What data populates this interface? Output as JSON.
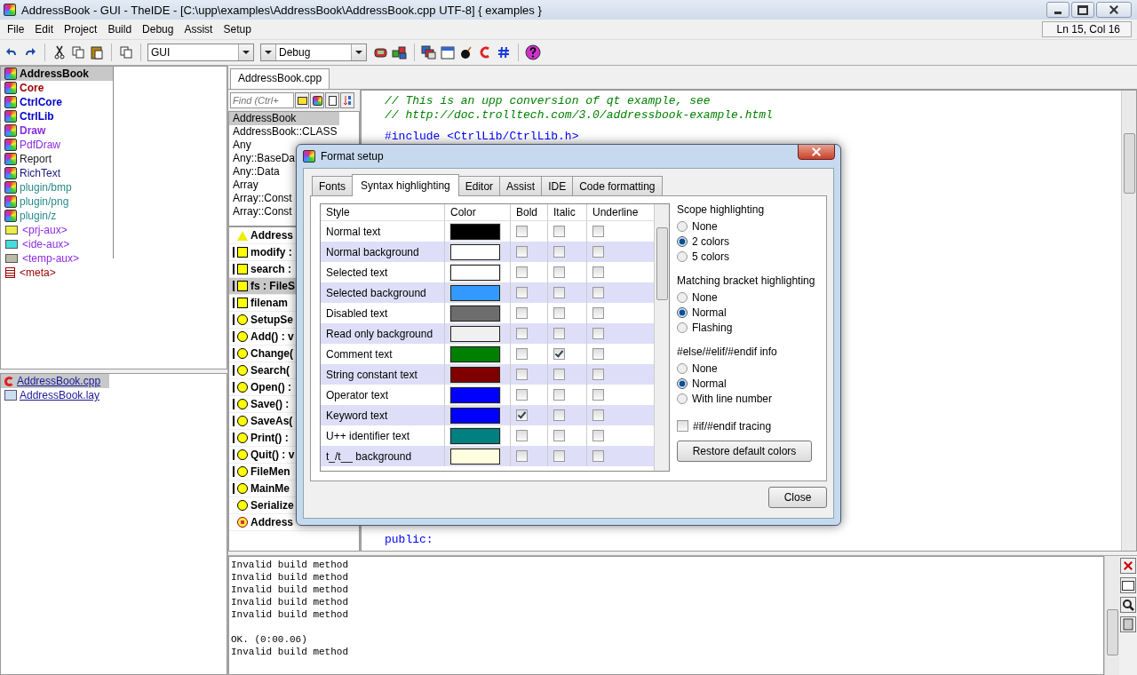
{
  "window": {
    "title": "AddressBook - GUI - TheIDE - [C:\\upp\\examples\\AddressBook\\AddressBook.cpp UTF-8] { examples }"
  },
  "menu": [
    "File",
    "Edit",
    "Project",
    "Build",
    "Debug",
    "Assist",
    "Setup"
  ],
  "status": "Ln 15, Col 16",
  "toolbar": {
    "config": "GUI",
    "build_mode": "Debug"
  },
  "packages": [
    {
      "name": "AddressBook",
      "color": "#000000",
      "bold": true,
      "selected": true
    },
    {
      "name": "Core",
      "color": "#990000",
      "bold": true,
      "selected": false
    },
    {
      "name": "CtrlCore",
      "color": "#0000cc",
      "bold": true,
      "selected": false
    },
    {
      "name": "CtrlLib",
      "color": "#0000cc",
      "bold": true,
      "selected": false
    },
    {
      "name": "Draw",
      "color": "#8a2be2",
      "bold": true,
      "selected": false
    },
    {
      "name": "PdfDraw",
      "color": "#8a2be2",
      "bold": false,
      "selected": false
    },
    {
      "name": "Report",
      "color": "#222222",
      "bold": false,
      "selected": false
    },
    {
      "name": "RichText",
      "color": "#1a1a7a",
      "bold": false,
      "selected": false
    },
    {
      "name": "plugin/bmp",
      "color": "#2a8a8a",
      "bold": false,
      "selected": false
    },
    {
      "name": "plugin/png",
      "color": "#2a8a8a",
      "bold": false,
      "selected": false
    },
    {
      "name": "plugin/z",
      "color": "#2a8a8a",
      "bold": false,
      "selected": false
    },
    {
      "name": "<prj-aux>",
      "kind": "aux",
      "color": "#8a2be2",
      "bold": false,
      "selected": false
    },
    {
      "name": "<ide-aux>",
      "kind": "aux",
      "color": "#8a2be2",
      "bold": false,
      "selected": false
    },
    {
      "name": "<temp-aux>",
      "kind": "aux",
      "color": "#8a2be2",
      "bold": false,
      "selected": false
    },
    {
      "name": "<meta>",
      "kind": "meta",
      "color": "#990000",
      "bold": false,
      "selected": false
    }
  ],
  "files": [
    {
      "name": "AddressBook.cpp",
      "kind": "cpp",
      "selected": true
    },
    {
      "name": "AddressBook.lay",
      "kind": "lay",
      "selected": false
    }
  ],
  "editor_tab": "AddressBook.cpp",
  "find": {
    "placeholder": "Find (Ctrl+"
  },
  "navigator": [
    {
      "text": "AddressBook",
      "selected": true
    },
    {
      "text": "AddressBook::CLASS",
      "selected": false
    },
    {
      "text": "Any",
      "selected": false
    },
    {
      "text": "Any::BaseDa",
      "selected": false
    },
    {
      "text": "Any::Data",
      "selected": false
    },
    {
      "text": "Array",
      "selected": false
    },
    {
      "text": "Array::Const",
      "selected": false
    },
    {
      "text": "Array::Const",
      "selected": false
    }
  ],
  "symbols": [
    {
      "text": "Address",
      "kind": "class",
      "selected": false
    },
    {
      "text": "modify :",
      "kind": "field",
      "selected": false
    },
    {
      "text": "search :",
      "kind": "field",
      "selected": false
    },
    {
      "text": "fs : FileS",
      "kind": "field",
      "selected": true
    },
    {
      "text": "filenam",
      "kind": "field",
      "selected": false
    },
    {
      "text": "SetupSe",
      "kind": "method",
      "selected": false
    },
    {
      "text": "Add() : v",
      "kind": "method",
      "selected": false
    },
    {
      "text": "Change(",
      "kind": "method",
      "selected": false
    },
    {
      "text": "Search(",
      "kind": "method",
      "selected": false
    },
    {
      "text": "Open() :",
      "kind": "method",
      "selected": false
    },
    {
      "text": "Save() :",
      "kind": "method",
      "selected": false
    },
    {
      "text": "SaveAs(",
      "kind": "method",
      "selected": false
    },
    {
      "text": "Print() :",
      "kind": "method",
      "selected": false
    },
    {
      "text": "Quit() : v",
      "kind": "method",
      "selected": false
    },
    {
      "text": "FileMen",
      "kind": "method",
      "selected": false
    },
    {
      "text": "MainMe",
      "kind": "method",
      "selected": false
    },
    {
      "text": "Serialize",
      "kind": "function",
      "selected": false
    },
    {
      "text": "Address",
      "kind": "constructor",
      "selected": false
    }
  ],
  "code": {
    "top": [
      {
        "text": "// This is an upp conversion of qt example, see",
        "kind": "comment"
      },
      {
        "text": "// http://doc.trolltech.com/3.0/addressbook-example.html",
        "kind": "comment"
      },
      {
        "text": "#include <CtrlLib/CtrlLib.h>",
        "kind": "preprocessor"
      }
    ],
    "bottom": [
      {
        "text": "public:",
        "kind": "keyword"
      }
    ]
  },
  "console": [
    "Invalid build method",
    "Invalid build method",
    "Invalid build method",
    "Invalid build method",
    "Invalid build method",
    "OK. (0:00.06)",
    "Invalid build method"
  ],
  "dialog": {
    "title": "Format setup",
    "tabs": [
      {
        "label": "Fonts",
        "selected": false
      },
      {
        "label": "Syntax highlighting",
        "selected": true
      },
      {
        "label": "Editor",
        "selected": false
      },
      {
        "label": "Assist",
        "selected": false
      },
      {
        "label": "IDE",
        "selected": false
      },
      {
        "label": "Code formatting",
        "selected": false
      }
    ],
    "columns": [
      "Style",
      "Color",
      "Bold",
      "Italic",
      "Underline"
    ],
    "styles": [
      {
        "name": "Normal text",
        "color": "#000000",
        "bold": false,
        "italic": false,
        "underline": false
      },
      {
        "name": "Normal background",
        "color": "#ffffff",
        "bold": false,
        "italic": false,
        "underline": false
      },
      {
        "name": "Selected text",
        "color": "#ffffff",
        "bold": false,
        "italic": false,
        "underline": false
      },
      {
        "name": "Selected background",
        "color": "#3399ff",
        "bold": false,
        "italic": false,
        "underline": false
      },
      {
        "name": "Disabled text",
        "color": "#6d6d6d",
        "bold": false,
        "italic": false,
        "underline": false
      },
      {
        "name": "Read only background",
        "color": "#f0f0f0",
        "bold": false,
        "italic": false,
        "underline": false
      },
      {
        "name": "Comment text",
        "color": "#008000",
        "bold": false,
        "italic": true,
        "underline": false
      },
      {
        "name": "String constant text",
        "color": "#800000",
        "bold": false,
        "italic": false,
        "underline": false
      },
      {
        "name": "Operator text",
        "color": "#0000ff",
        "bold": false,
        "italic": false,
        "underline": false
      },
      {
        "name": "Keyword text",
        "color": "#0000ff",
        "bold": true,
        "italic": false,
        "underline": false
      },
      {
        "name": "U++ identifier text",
        "color": "#008080",
        "bold": false,
        "italic": false,
        "underline": false
      },
      {
        "name": "t_/t__ background",
        "color": "#ffffe0",
        "bold": false,
        "italic": false,
        "underline": false
      }
    ],
    "groups": [
      {
        "title": "Scope highlighting",
        "options": [
          {
            "label": "None",
            "selected": false
          },
          {
            "label": "2 colors",
            "selected": true
          },
          {
            "label": "5 colors",
            "selected": false
          }
        ]
      },
      {
        "title": "Matching bracket highlighting",
        "options": [
          {
            "label": "None",
            "selected": false
          },
          {
            "label": "Normal",
            "selected": true
          },
          {
            "label": "Flashing",
            "selected": false
          }
        ]
      },
      {
        "title": "#else/#elif/#endif info",
        "options": [
          {
            "label": "None",
            "selected": false
          },
          {
            "label": "Normal",
            "selected": true
          },
          {
            "label": "With line number",
            "selected": false
          }
        ]
      }
    ],
    "tracing": {
      "label": "#if/#endif tracing",
      "checked": false
    },
    "restore": "Restore default colors",
    "close": "Close"
  }
}
